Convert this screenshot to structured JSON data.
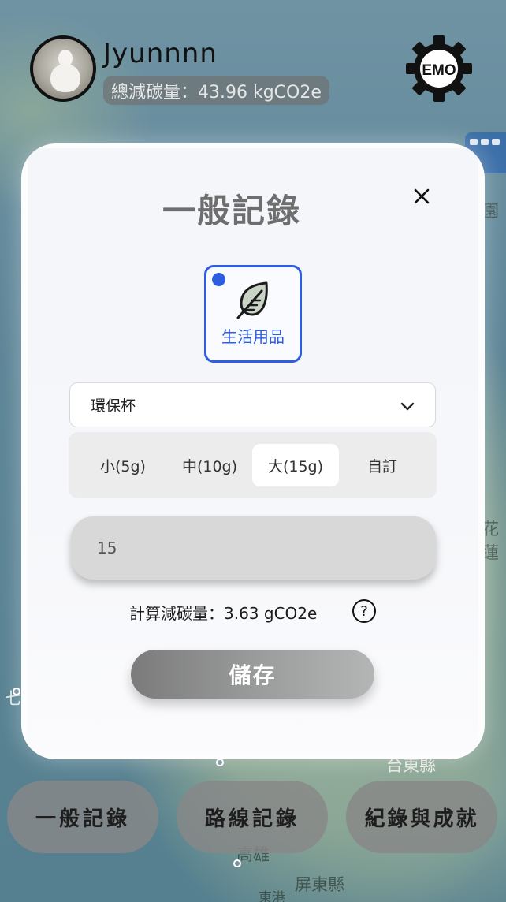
{
  "map": {
    "labels": [
      "園",
      "花蓮",
      "七",
      "台東縣",
      "高雄",
      "屏東縣",
      "東港"
    ]
  },
  "header": {
    "username": "Jyunnnn",
    "total_reduction": "總減碳量：43.96 kgCO2e",
    "emo_label": "EMO"
  },
  "modal": {
    "title": "一般記錄",
    "close_icon": "close-icon",
    "category": {
      "label": "生活用品",
      "icon": "leaf-icon",
      "selected": true
    },
    "item_select": {
      "value": "環保杯"
    },
    "sizes": [
      {
        "label": "小(5g)",
        "active": false
      },
      {
        "label": "中(10g)",
        "active": false
      },
      {
        "label": "大(15g)",
        "active": true
      },
      {
        "label": "自訂",
        "active": false
      }
    ],
    "amount_value": "15",
    "calc_text": "計算減碳量：3.63 gCO2e",
    "help_label": "?",
    "save_label": "儲存"
  },
  "nav": {
    "general": "一般記錄",
    "route": "路線記錄",
    "achievements": "紀錄與成就"
  },
  "colors": {
    "accent": "#2f5de0",
    "nav_bg": "#878787"
  }
}
